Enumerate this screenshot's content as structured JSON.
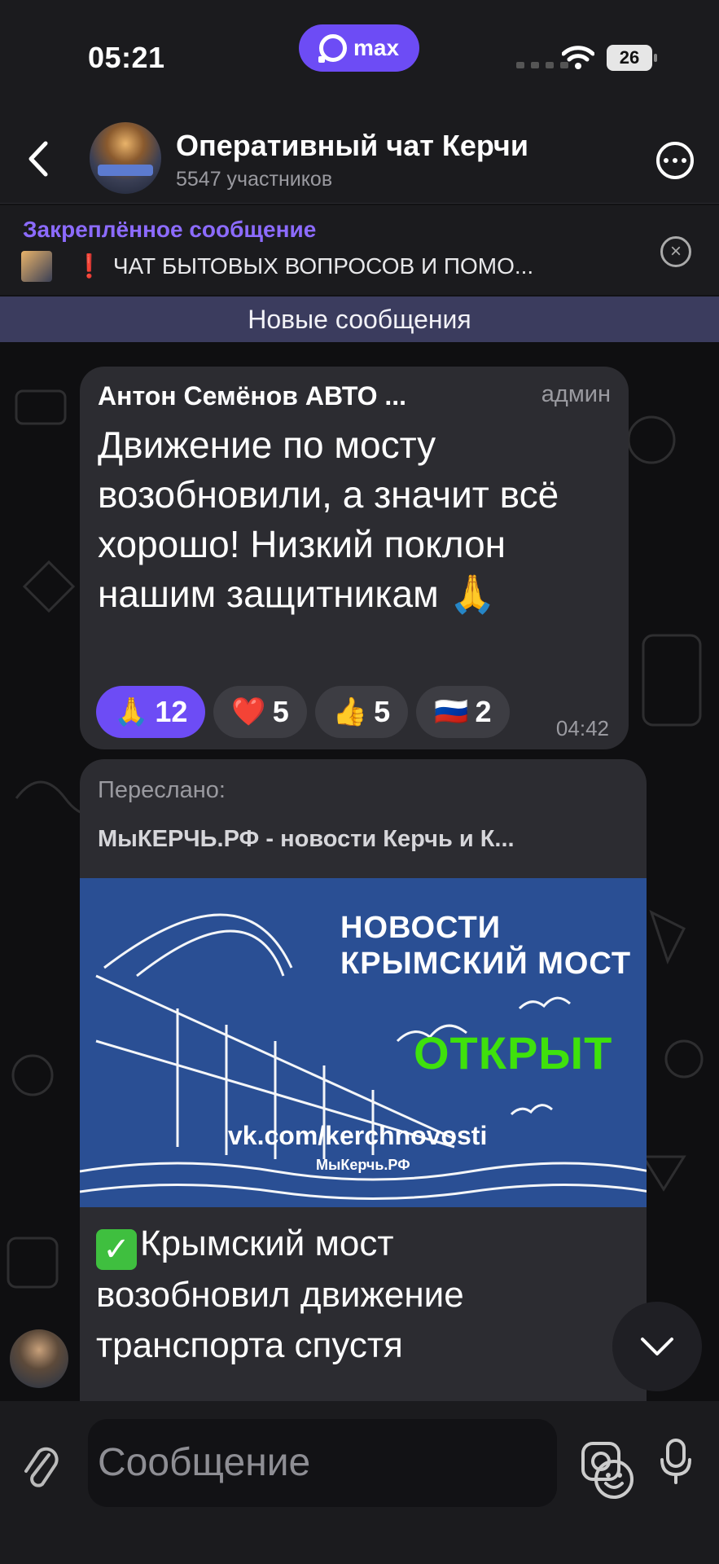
{
  "status": {
    "time": "05:21",
    "app_badge": "max",
    "battery": "26"
  },
  "header": {
    "title": "Оперативный чат Керчи",
    "subtitle": "5547 участников"
  },
  "pinned": {
    "title": "Закреплённое сообщение",
    "text": "ЧАТ БЫТОВЫХ ВОПРОСОВ И ПОМО...",
    "marker": "❗"
  },
  "divider": "Новые сообщения",
  "messages": [
    {
      "sender": "Антон Семёнов АВТО ...",
      "role": "админ",
      "text": "Движение по мосту возобновили, а значит всё хорошо! Низкий поклон нашим защитникам 🙏",
      "time": "04:42",
      "reactions": [
        {
          "emoji": "🙏",
          "count": "12",
          "active": true
        },
        {
          "emoji": "❤️",
          "count": "5",
          "active": false
        },
        {
          "emoji": "👍",
          "count": "5",
          "active": false
        },
        {
          "emoji": "🇷🇺",
          "count": "2",
          "active": false
        }
      ]
    },
    {
      "forwarded_label": "Переслано:",
      "forwarded_from": "МыКЕРЧЬ.РФ - новости Керчь и К...",
      "image": {
        "line1": "НОВОСТИ",
        "line2": "КРЫМСКИЙ МОСТ",
        "status": "ОТКРЫТ",
        "url": "vk.com/kerchnovosti",
        "brand": "МыКерчь.РФ"
      },
      "text": "Крымский мост возобновил движение транспорта спустя"
    }
  ],
  "composer": {
    "placeholder": "Сообщение"
  },
  "colors": {
    "accent": "#6d4cf5",
    "pinned_title": "#8c6bff",
    "open_green": "#3fe10c",
    "bubble": "#2c2c31"
  }
}
